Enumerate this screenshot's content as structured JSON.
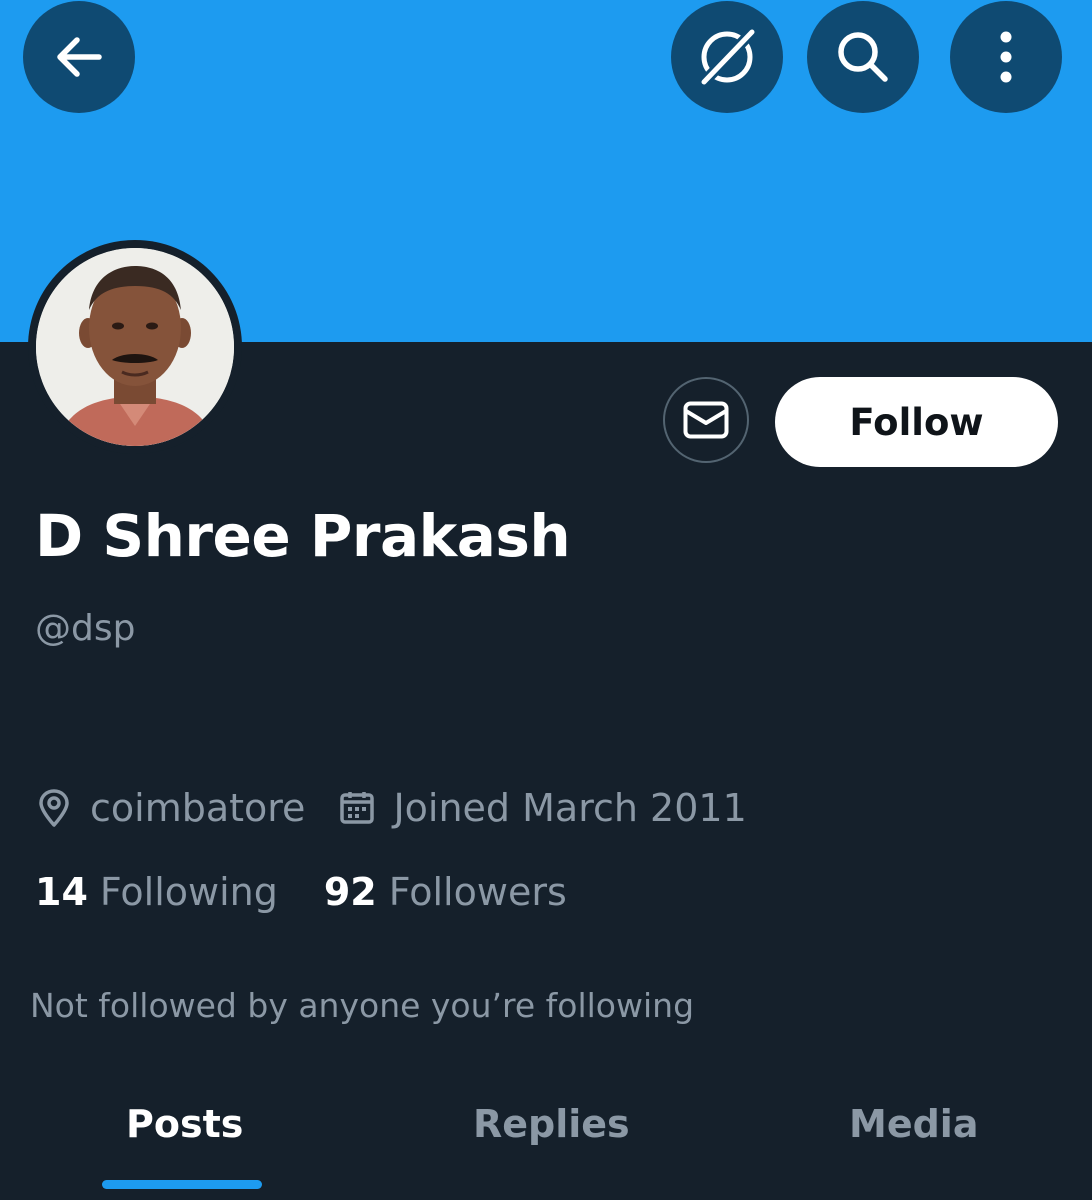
{
  "colors": {
    "banner": "#1d9bf0",
    "background": "#15202b",
    "accent": "#1d9bf0",
    "muted_text": "#8b98a5"
  },
  "header": {
    "back_icon": "arrow-left-icon",
    "grok_icon": "grok-icon",
    "search_icon": "search-icon",
    "more_icon": "more-vertical-icon"
  },
  "profile": {
    "display_name": "D Shree Prakash",
    "handle": "@dsp",
    "location": "coimbatore",
    "joined": "Joined March 2011",
    "following_count": "14",
    "following_label": "Following",
    "followers_count": "92",
    "followers_label": "Followers",
    "followed_by": "Not followed by anyone you’re following"
  },
  "actions": {
    "message_icon": "mail-icon",
    "follow_label": "Follow"
  },
  "tabs": [
    {
      "label": "Posts",
      "active": true
    },
    {
      "label": "Replies",
      "active": false
    },
    {
      "label": "Media",
      "active": false
    }
  ]
}
